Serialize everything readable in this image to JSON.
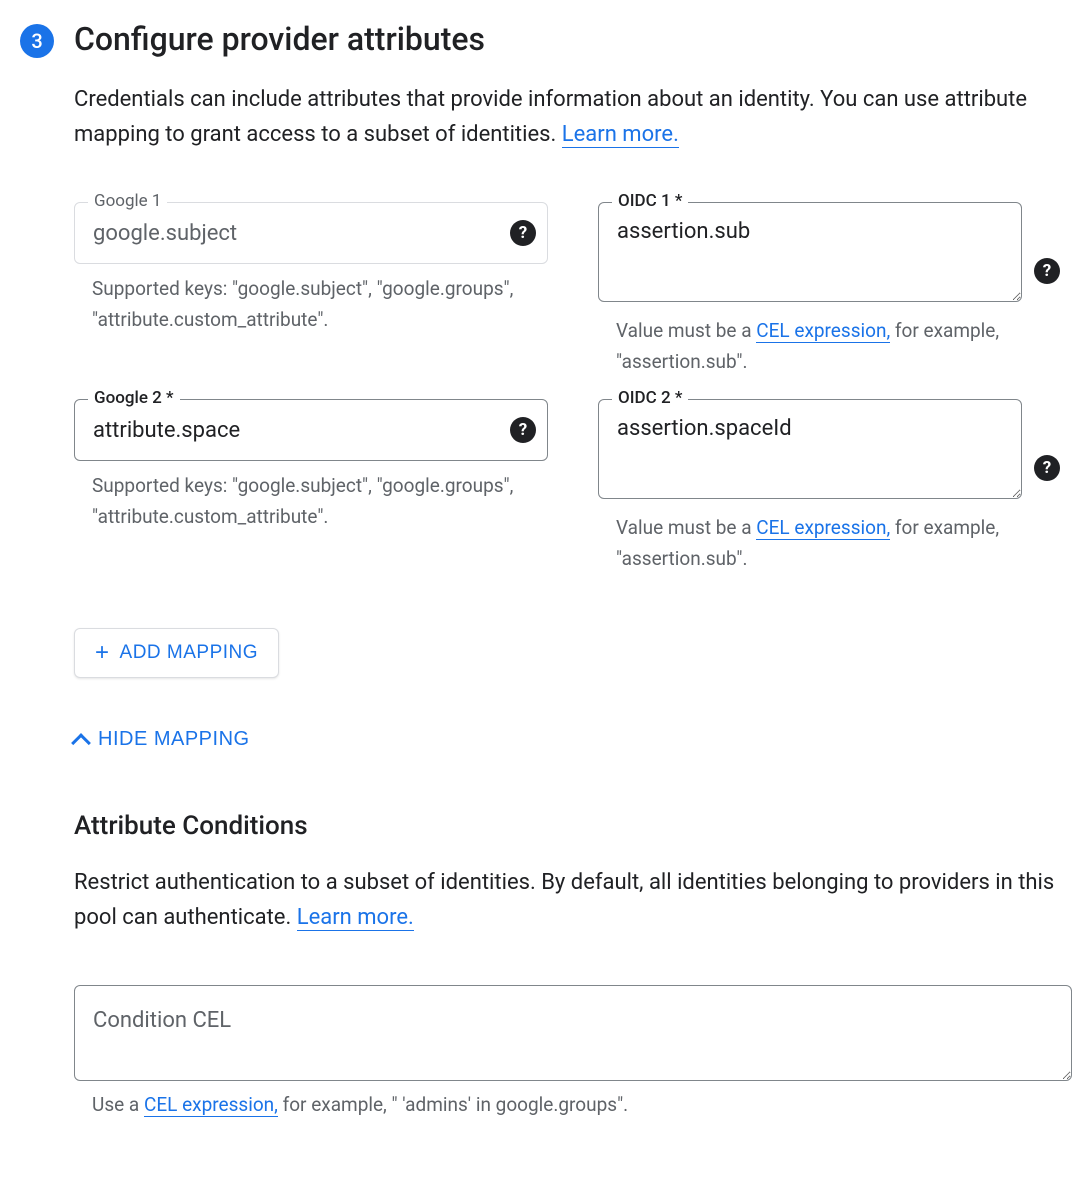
{
  "step": {
    "number": "3",
    "title": "Configure provider attributes",
    "description_pre": "Credentials can include attributes that provide information about an identity. You can use attribute mapping to grant access to a subset of identities. ",
    "learn_more": "Learn more."
  },
  "mappings": [
    {
      "google": {
        "label": "Google 1",
        "value": "google.subject",
        "disabled": true,
        "helper": "Supported keys: \"google.subject\", \"google.groups\", \"attribute.custom_attribute\"."
      },
      "oidc": {
        "label": "OIDC 1 *",
        "value": "assertion.sub",
        "helper_pre": "Value must be a ",
        "helper_link": "CEL expression,",
        "helper_post": " for example, \"assertion.sub\"."
      }
    },
    {
      "google": {
        "label": "Google 2 *",
        "value": "attribute.space",
        "disabled": false,
        "helper": "Supported keys: \"google.subject\", \"google.groups\", \"attribute.custom_attribute\"."
      },
      "oidc": {
        "label": "OIDC 2 *",
        "value": "assertion.spaceId",
        "helper_pre": "Value must be a ",
        "helper_link": "CEL expression,",
        "helper_post": " for example, \"assertion.sub\"."
      }
    }
  ],
  "buttons": {
    "add_mapping": "ADD MAPPING",
    "hide_mapping": "HIDE MAPPING"
  },
  "conditions": {
    "title": "Attribute Conditions",
    "description_pre": "Restrict authentication to a subset of identities. By default, all identities belonging to providers in this pool can authenticate. ",
    "learn_more": "Learn more.",
    "placeholder": "Condition CEL",
    "value": "",
    "helper_pre": "Use a ",
    "helper_link": "CEL expression,",
    "helper_post": " for example, \" 'admins' in google.groups\"."
  }
}
